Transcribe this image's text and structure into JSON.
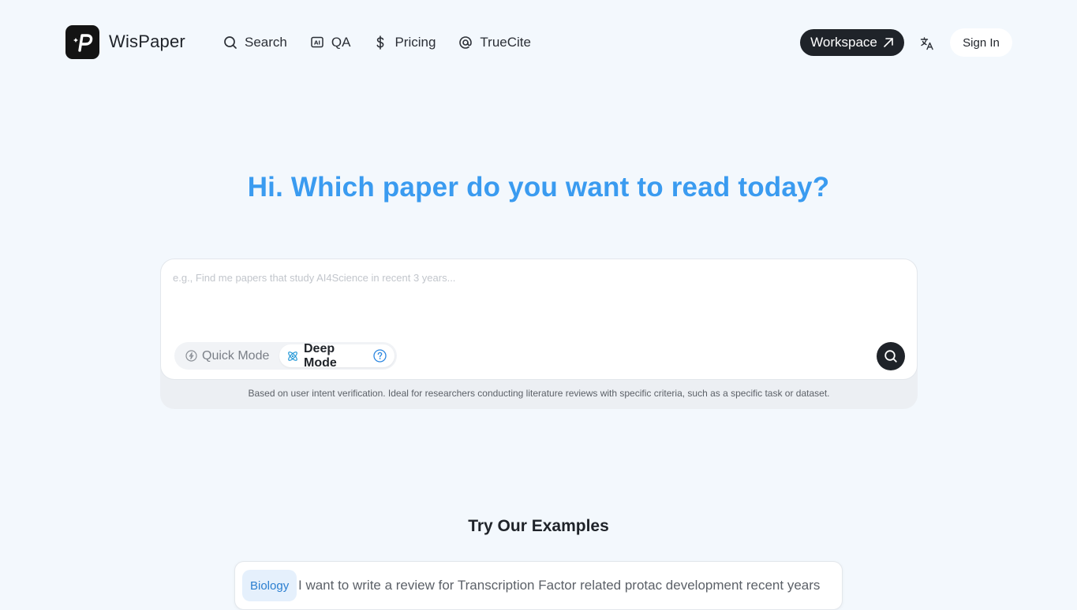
{
  "brand": {
    "name": "WisPaper",
    "logo_icon": "wispaper-logo-icon"
  },
  "nav": {
    "items": [
      {
        "label": "Search",
        "icon": "search-icon"
      },
      {
        "label": "QA",
        "icon": "ai-box-icon"
      },
      {
        "label": "Pricing",
        "icon": "dollar-icon"
      },
      {
        "label": "TrueCite",
        "icon": "at-sign-icon"
      }
    ]
  },
  "header": {
    "workspace_label": "Workspace",
    "language_icon": "translate-icon",
    "signin_label": "Sign In"
  },
  "hero": {
    "title": "Hi. Which paper do you want to read today?"
  },
  "search": {
    "placeholder": "e.g., Find me papers that study AI4Science in recent 3 years...",
    "value": "",
    "modes": [
      {
        "label": "Quick Mode",
        "icon": "lightning-icon",
        "selected": false
      },
      {
        "label": "Deep Mode",
        "icon": "atom-icon",
        "selected": true
      }
    ],
    "mode_description": "Based on user intent verification. Ideal for researchers conducting literature reviews with specific criteria, such as a specific task or dataset."
  },
  "examples": {
    "title": "Try Our Examples",
    "items": [
      {
        "tag": "Biology",
        "text": "I want to write a review for Transcription Factor related protac development recent years"
      }
    ]
  },
  "colors": {
    "accent": "#3a9bf0",
    "dark": "#1f2329",
    "background": "#f3f8fd",
    "tag_bg": "#e5f0fc",
    "tag_text": "#2b7fd0"
  }
}
